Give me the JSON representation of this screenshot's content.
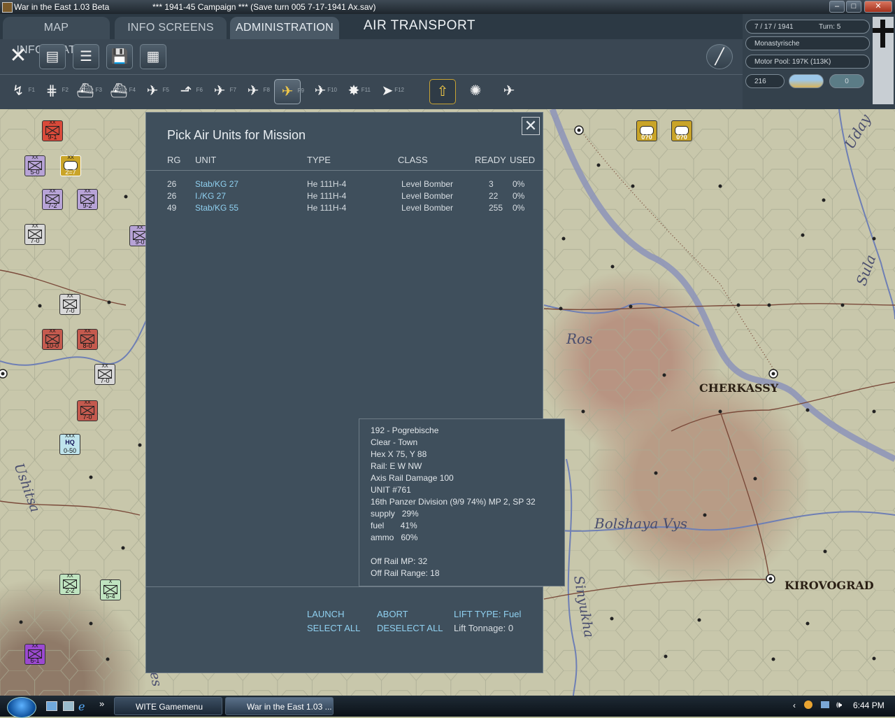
{
  "window": {
    "app_title": "War in the East 1.03 Beta",
    "campaign_title": "***   1941-45 Campaign   ***  (Save turn 005 7-17-1941 Ax.sav)"
  },
  "tabs": [
    "MAP INFORMATION",
    "INFO SCREENS",
    "ADMINISTRATION"
  ],
  "screen_title": "AIR TRANSPORT",
  "status": {
    "date": "7 / 17 / 1941",
    "turn": "Turn: 5",
    "location": "Monastyrische",
    "motor_pool": "Motor Pool:  197K (113K)",
    "counter": "216",
    "toggle_value": "0"
  },
  "toolbar": {
    "fkeys": [
      "F1",
      "F2",
      "F3",
      "F4",
      "F5",
      "F6",
      "F7",
      "F8",
      "F9",
      "F10",
      "F11",
      "F12"
    ]
  },
  "dialog": {
    "title": "Pick Air Units for Mission",
    "columns": [
      "RG",
      "UNIT",
      "TYPE",
      "CLASS",
      "READY",
      "USED"
    ],
    "rows": [
      {
        "rg": "26",
        "unit": "Stab/KG 27",
        "type": "He 111H-4",
        "class": "Level Bomber",
        "ready": "3",
        "used": "0%"
      },
      {
        "rg": "26",
        "unit": "I./KG 27",
        "type": "He 111H-4",
        "class": "Level Bomber",
        "ready": "22",
        "used": "0%"
      },
      {
        "rg": "49",
        "unit": "Stab/KG 55",
        "type": "He 111H-4",
        "class": "Level Bomber",
        "ready": "255",
        "used": "0%"
      }
    ],
    "launch": "LAUNCH",
    "abort": "ABORT",
    "select_all": "SELECT ALL",
    "deselect_all": "DESELECT ALL",
    "lift_type": "LIFT TYPE:  Fuel",
    "lift_tonnage": "Lift Tonnage:  0"
  },
  "hex_info": {
    "lines": [
      "192 - Pogrebische",
      "Clear - Town",
      "Hex X 75, Y 88",
      "Rail: E W NW",
      "Axis Rail  Damage 100",
      "UNIT #761",
      "16th Panzer Division    (9/9 74%) MP 2, SP 32",
      "supply   29%",
      "fuel       41%",
      "ammo   60%",
      "",
      "Off Rail MP: 32",
      "Off Rail Range: 18"
    ]
  },
  "map": {
    "cities": [
      "CHERKASSY",
      "KIROVOGRAD"
    ],
    "rivers": [
      "Uday",
      "Sula",
      "Ros",
      "Bolshaya Vys",
      "Sinyukha",
      "Ushitsa",
      "Dnes"
    ],
    "units": [
      {
        "value": "9-1",
        "color": "#d94a3a"
      },
      {
        "value": "5-0",
        "color": "#b7a3d6"
      },
      {
        "value": "2=7",
        "color": "#c9a428"
      },
      {
        "value": "7-2",
        "color": "#b7a3d6"
      },
      {
        "value": "9-2",
        "color": "#b7a3d6"
      },
      {
        "value": "7-0",
        "color": "#d8d8d8"
      },
      {
        "value": "9-0",
        "color": "#b7a3d6"
      },
      {
        "value": "7-0",
        "color": "#d8d8d8"
      },
      {
        "value": "10-0",
        "color": "#c45a4e"
      },
      {
        "value": "8-0",
        "color": "#c45a4e"
      },
      {
        "value": "7-0",
        "color": "#d8d8d8"
      },
      {
        "value": "7-0",
        "color": "#c45a4e"
      },
      {
        "value": "0-50",
        "color": "#bfe4ec"
      },
      {
        "value": "2-2",
        "color": "#bfe4c0"
      },
      {
        "value": "5-4",
        "color": "#bfe4c0"
      },
      {
        "value": "6-1",
        "color": "#9b49d0"
      },
      {
        "value": "0?0",
        "color": "#c9a428"
      },
      {
        "value": "0?0",
        "color": "#c9a428"
      }
    ],
    "hq_label": "HQ"
  },
  "taskbar": {
    "items": [
      "WITE Gamemenu",
      "War in the East 1.03 ..."
    ],
    "clock": "6:44 PM"
  }
}
